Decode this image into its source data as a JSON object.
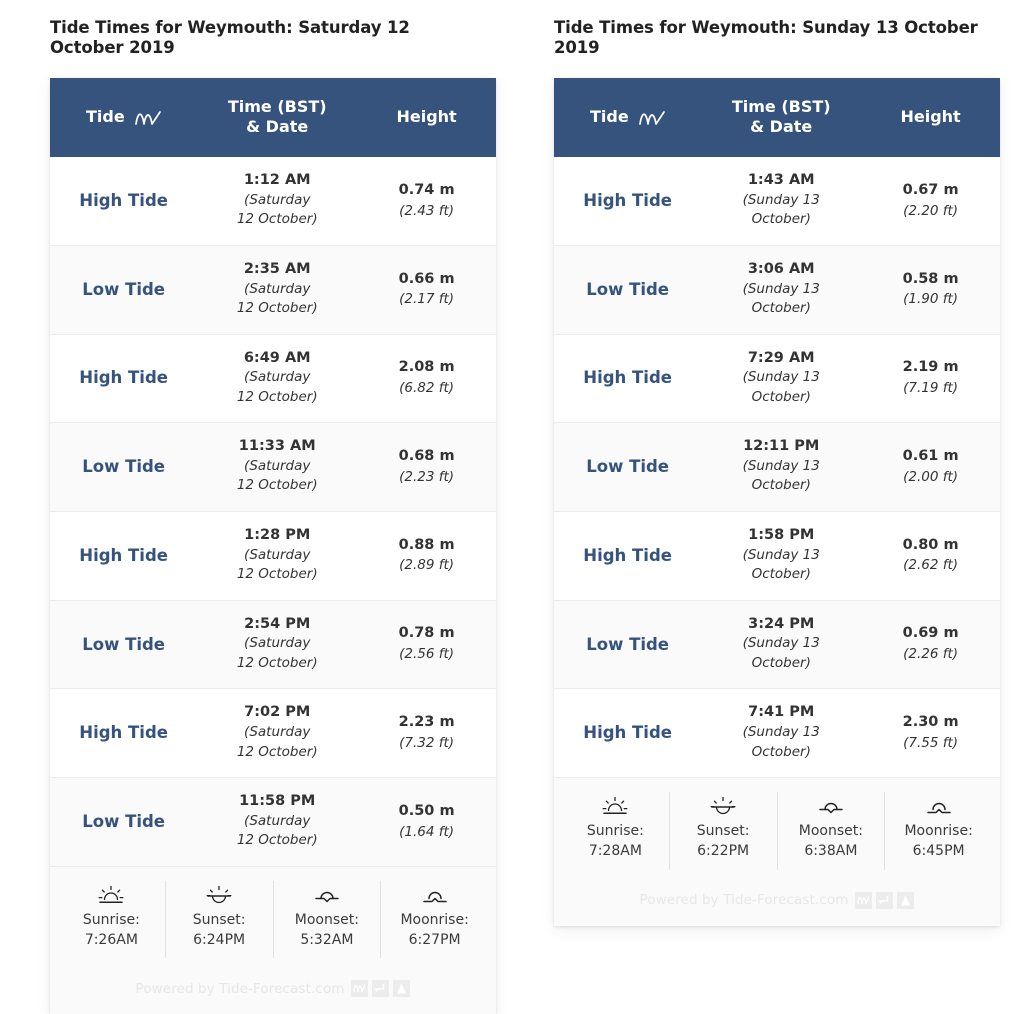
{
  "panels": [
    {
      "title": "Tide Times for Weymouth: Saturday 12 October 2019",
      "columns": {
        "tide": "Tide",
        "time": "Time (BST)",
        "time_sub": "& Date",
        "height": "Height"
      },
      "rows": [
        {
          "tide": "High Tide",
          "time": "1:12 AM",
          "date": "(Saturday 12 October)",
          "height_m": "0.74 m",
          "height_ft": "(2.43 ft)"
        },
        {
          "tide": "Low Tide",
          "time": "2:35 AM",
          "date": "(Saturday 12 October)",
          "height_m": "0.66 m",
          "height_ft": "(2.17 ft)"
        },
        {
          "tide": "High Tide",
          "time": "6:49 AM",
          "date": "(Saturday 12 October)",
          "height_m": "2.08 m",
          "height_ft": "(6.82 ft)"
        },
        {
          "tide": "Low Tide",
          "time": "11:33 AM",
          "date": "(Saturday 12 October)",
          "height_m": "0.68 m",
          "height_ft": "(2.23 ft)"
        },
        {
          "tide": "High Tide",
          "time": "1:28 PM",
          "date": "(Saturday 12 October)",
          "height_m": "0.88 m",
          "height_ft": "(2.89 ft)"
        },
        {
          "tide": "Low Tide",
          "time": "2:54 PM",
          "date": "(Saturday 12 October)",
          "height_m": "0.78 m",
          "height_ft": "(2.56 ft)"
        },
        {
          "tide": "High Tide",
          "time": "7:02 PM",
          "date": "(Saturday 12 October)",
          "height_m": "2.23 m",
          "height_ft": "(7.32 ft)"
        },
        {
          "tide": "Low Tide",
          "time": "11:58 PM",
          "date": "(Saturday 12 October)",
          "height_m": "0.50 m",
          "height_ft": "(1.64 ft)"
        }
      ],
      "astro": [
        {
          "icon": "sunrise-icon",
          "label": "Sunrise:",
          "time": "7:26AM"
        },
        {
          "icon": "sunset-icon",
          "label": "Sunset:",
          "time": "6:24PM"
        },
        {
          "icon": "moonset-icon",
          "label": "Moonset:",
          "time": "5:32AM"
        },
        {
          "icon": "moonrise-icon",
          "label": "Moonrise:",
          "time": "6:27PM"
        }
      ],
      "powered_by": "Powered by Tide-Forecast.com"
    },
    {
      "title": "Tide Times for Weymouth: Sunday 13 October 2019",
      "columns": {
        "tide": "Tide",
        "time": "Time (BST)",
        "time_sub": "& Date",
        "height": "Height"
      },
      "rows": [
        {
          "tide": "High Tide",
          "time": "1:43 AM",
          "date": "(Sunday 13 October)",
          "height_m": "0.67 m",
          "height_ft": "(2.20 ft)"
        },
        {
          "tide": "Low Tide",
          "time": "3:06 AM",
          "date": "(Sunday 13 October)",
          "height_m": "0.58 m",
          "height_ft": "(1.90 ft)"
        },
        {
          "tide": "High Tide",
          "time": "7:29 AM",
          "date": "(Sunday 13 October)",
          "height_m": "2.19 m",
          "height_ft": "(7.19 ft)"
        },
        {
          "tide": "Low Tide",
          "time": "12:11 PM",
          "date": "(Sunday 13 October)",
          "height_m": "0.61 m",
          "height_ft": "(2.00 ft)"
        },
        {
          "tide": "High Tide",
          "time": "1:58 PM",
          "date": "(Sunday 13 October)",
          "height_m": "0.80 m",
          "height_ft": "(2.62 ft)"
        },
        {
          "tide": "Low Tide",
          "time": "3:24 PM",
          "date": "(Sunday 13 October)",
          "height_m": "0.69 m",
          "height_ft": "(2.26 ft)"
        },
        {
          "tide": "High Tide",
          "time": "7:41 PM",
          "date": "(Sunday 13 October)",
          "height_m": "2.30 m",
          "height_ft": "(7.55 ft)"
        }
      ],
      "astro": [
        {
          "icon": "sunrise-icon",
          "label": "Sunrise:",
          "time": "7:28AM"
        },
        {
          "icon": "sunset-icon",
          "label": "Sunset:",
          "time": "6:22PM"
        },
        {
          "icon": "moonset-icon",
          "label": "Moonset:",
          "time": "6:38AM"
        },
        {
          "icon": "moonrise-icon",
          "label": "Moonrise:",
          "time": "6:45PM"
        }
      ],
      "powered_by": "Powered by Tide-Forecast.com"
    }
  ],
  "icons": {
    "header_wave": "wave-icon",
    "powered_icons": [
      "wave-chart-icon",
      "download-arrow-icon",
      "mountain-icon"
    ]
  },
  "colors": {
    "header_blue": "#35537d",
    "tide_label_blue": "#35537d",
    "row_alt": "#fafafa",
    "text": "#333333",
    "watermark": "#e7e7e7"
  }
}
